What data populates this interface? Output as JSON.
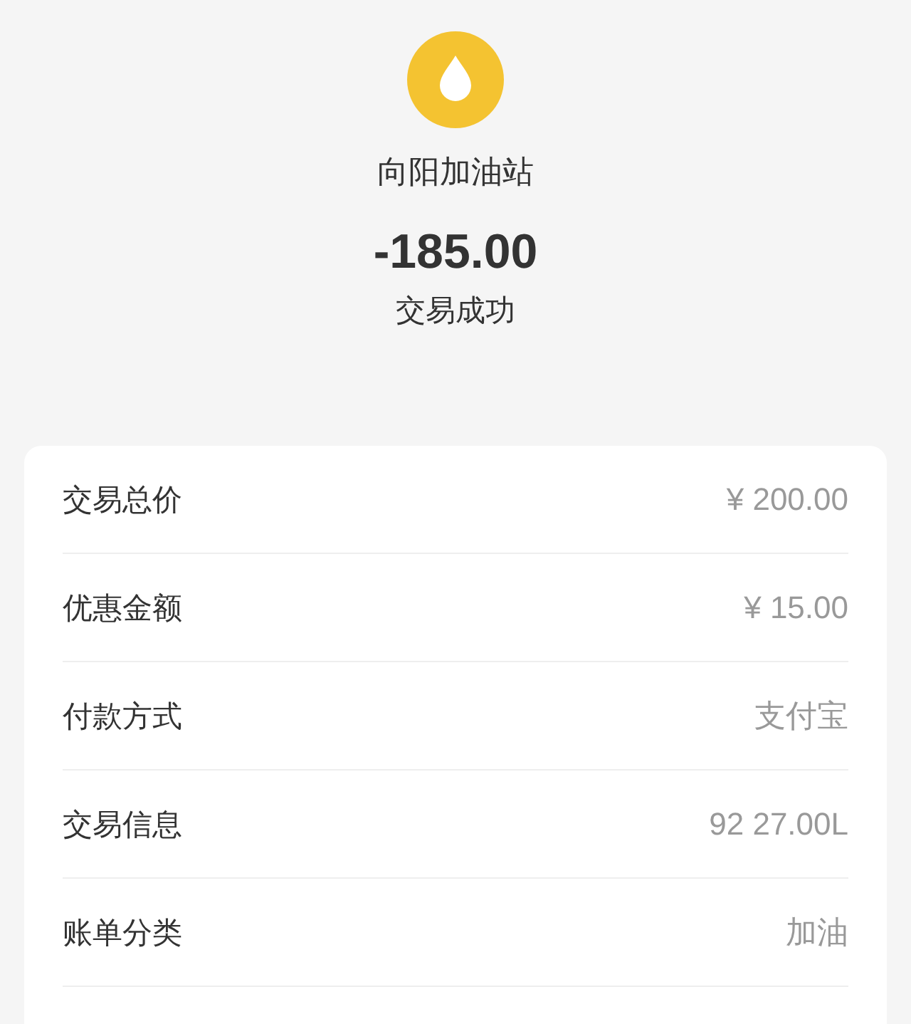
{
  "merchant": {
    "name": "向阳加油站"
  },
  "amount": "-185.00",
  "status": "交易成功",
  "details": [
    {
      "label": "交易总价",
      "value": "¥ 200.00"
    },
    {
      "label": "优惠金额",
      "value": "¥ 15.00"
    },
    {
      "label": "付款方式",
      "value": "支付宝"
    },
    {
      "label": "交易信息",
      "value": "92 27.00L"
    },
    {
      "label": "账单分类",
      "value": "加油"
    }
  ]
}
